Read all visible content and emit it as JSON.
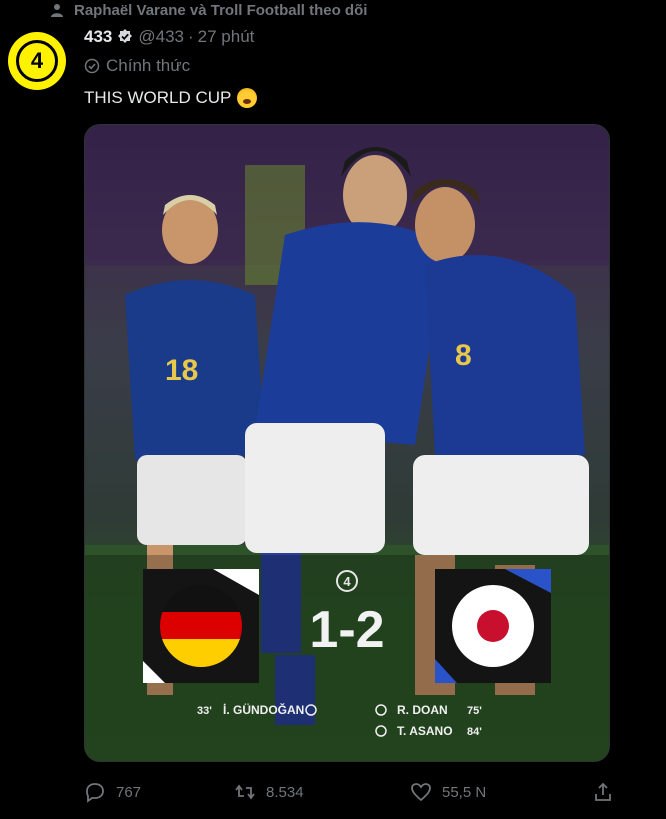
{
  "social_context": {
    "text": "Raphaël Varane và Troll Football theo dõi"
  },
  "author": {
    "avatar_text": "4",
    "display_name": "433",
    "handle": "@433",
    "separator": "·",
    "time": "27 phút",
    "official_label": "Chính thức"
  },
  "tweet": {
    "text": "THIS WORLD CUP"
  },
  "media": {
    "match_badge": "4",
    "score": "1-2",
    "home_scorers": [
      {
        "minute": "33'",
        "name": "İ. GÜNDOĞAN"
      }
    ],
    "away_scorers": [
      {
        "name": "R. DOAN",
        "minute": "75'"
      },
      {
        "name": "T. ASANO",
        "minute": "84'"
      }
    ]
  },
  "actions": {
    "replies": "767",
    "retweets": "8.534",
    "likes": "55,5 N"
  },
  "colors": {
    "avatar": "#fff200",
    "muted": "#71767b",
    "text": "#e7e9ea"
  }
}
